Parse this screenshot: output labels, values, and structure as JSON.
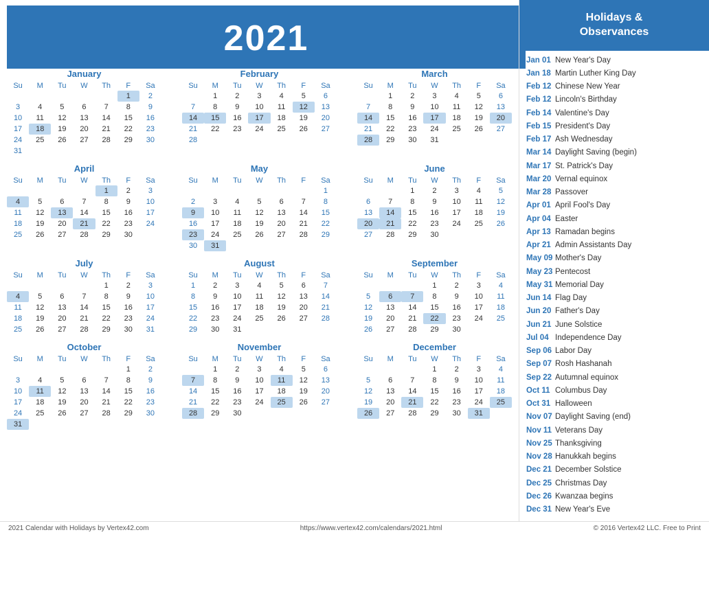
{
  "header": {
    "year": "2021"
  },
  "sidebar": {
    "title": "Holidays &\nObservances",
    "holidays": [
      {
        "date": "Jan 01",
        "name": "New Year's Day"
      },
      {
        "date": "Jan 18",
        "name": "Martin Luther King Day"
      },
      {
        "date": "Feb 12",
        "name": "Chinese New Year"
      },
      {
        "date": "Feb 12",
        "name": "Lincoln's Birthday"
      },
      {
        "date": "Feb 14",
        "name": "Valentine's Day"
      },
      {
        "date": "Feb 15",
        "name": "President's Day"
      },
      {
        "date": "Feb 17",
        "name": "Ash Wednesday"
      },
      {
        "date": "Mar 14",
        "name": "Daylight Saving (begin)"
      },
      {
        "date": "Mar 17",
        "name": "St. Patrick's Day"
      },
      {
        "date": "Mar 20",
        "name": "Vernal equinox"
      },
      {
        "date": "Mar 28",
        "name": "Passover"
      },
      {
        "date": "Apr 01",
        "name": "April Fool's Day"
      },
      {
        "date": "Apr 04",
        "name": "Easter"
      },
      {
        "date": "Apr 13",
        "name": "Ramadan begins"
      },
      {
        "date": "Apr 21",
        "name": "Admin Assistants Day"
      },
      {
        "date": "May 09",
        "name": "Mother's Day"
      },
      {
        "date": "May 23",
        "name": "Pentecost"
      },
      {
        "date": "May 31",
        "name": "Memorial Day"
      },
      {
        "date": "Jun 14",
        "name": "Flag Day"
      },
      {
        "date": "Jun 20",
        "name": "Father's Day"
      },
      {
        "date": "Jun 21",
        "name": "June Solstice"
      },
      {
        "date": "Jul 04",
        "name": "Independence Day"
      },
      {
        "date": "Sep 06",
        "name": "Labor Day"
      },
      {
        "date": "Sep 07",
        "name": "Rosh Hashanah"
      },
      {
        "date": "Sep 22",
        "name": "Autumnal equinox"
      },
      {
        "date": "Oct 11",
        "name": "Columbus Day"
      },
      {
        "date": "Oct 31",
        "name": "Halloween"
      },
      {
        "date": "Nov 07",
        "name": "Daylight Saving (end)"
      },
      {
        "date": "Nov 11",
        "name": "Veterans Day"
      },
      {
        "date": "Nov 25",
        "name": "Thanksgiving"
      },
      {
        "date": "Nov 28",
        "name": "Hanukkah begins"
      },
      {
        "date": "Dec 21",
        "name": "December Solstice"
      },
      {
        "date": "Dec 25",
        "name": "Christmas Day"
      },
      {
        "date": "Dec 26",
        "name": "Kwanzaa begins"
      },
      {
        "date": "Dec 31",
        "name": "New Year's Eve"
      }
    ]
  },
  "footer": {
    "left": "2021 Calendar with Holidays by Vertex42.com",
    "center": "https://www.vertex42.com/calendars/2021.html",
    "right": "© 2016 Vertex42 LLC. Free to Print"
  },
  "months": [
    {
      "name": "January",
      "weeks": [
        [
          "",
          "",
          "",
          "",
          "",
          "1",
          "2"
        ],
        [
          "3",
          "4",
          "5",
          "6",
          "7",
          "8",
          "9"
        ],
        [
          "10",
          "11",
          "12",
          "13",
          "14",
          "15",
          "16"
        ],
        [
          "17",
          "18",
          "19",
          "20",
          "21",
          "22",
          "23"
        ],
        [
          "24",
          "25",
          "26",
          "27",
          "28",
          "29",
          "30"
        ],
        [
          "31",
          "",
          "",
          "",
          "",
          "",
          ""
        ]
      ],
      "highlights": [
        "1",
        "18"
      ],
      "today": []
    },
    {
      "name": "February",
      "weeks": [
        [
          "",
          "1",
          "2",
          "3",
          "4",
          "5",
          "6"
        ],
        [
          "7",
          "8",
          "9",
          "10",
          "11",
          "12",
          "13"
        ],
        [
          "14",
          "15",
          "16",
          "17",
          "18",
          "19",
          "20"
        ],
        [
          "21",
          "22",
          "23",
          "24",
          "25",
          "26",
          "27"
        ],
        [
          "28",
          "",
          "",
          "",
          "",
          "",
          ""
        ]
      ],
      "highlights": [
        "12",
        "14",
        "15",
        "17"
      ],
      "today": []
    },
    {
      "name": "March",
      "weeks": [
        [
          "",
          "1",
          "2",
          "3",
          "4",
          "5",
          "6"
        ],
        [
          "7",
          "8",
          "9",
          "10",
          "11",
          "12",
          "13"
        ],
        [
          "14",
          "15",
          "16",
          "17",
          "18",
          "19",
          "20"
        ],
        [
          "21",
          "22",
          "23",
          "24",
          "25",
          "26",
          "27"
        ],
        [
          "28",
          "29",
          "30",
          "31",
          "",
          "",
          ""
        ]
      ],
      "highlights": [
        "14",
        "17",
        "20",
        "28"
      ],
      "today": []
    },
    {
      "name": "April",
      "weeks": [
        [
          "",
          "",
          "",
          "",
          "1",
          "2",
          "3"
        ],
        [
          "4",
          "5",
          "6",
          "7",
          "8",
          "9",
          "10"
        ],
        [
          "11",
          "12",
          "13",
          "14",
          "15",
          "16",
          "17"
        ],
        [
          "18",
          "19",
          "20",
          "21",
          "22",
          "23",
          "24"
        ],
        [
          "25",
          "26",
          "27",
          "28",
          "29",
          "30",
          ""
        ]
      ],
      "highlights": [
        "1",
        "4",
        "13",
        "21"
      ],
      "today": []
    },
    {
      "name": "May",
      "weeks": [
        [
          "",
          "",
          "",
          "",
          "",
          "",
          "1"
        ],
        [
          "2",
          "3",
          "4",
          "5",
          "6",
          "7",
          "8"
        ],
        [
          "9",
          "10",
          "11",
          "12",
          "13",
          "14",
          "15"
        ],
        [
          "16",
          "17",
          "18",
          "19",
          "20",
          "21",
          "22"
        ],
        [
          "23",
          "24",
          "25",
          "26",
          "27",
          "28",
          "29"
        ],
        [
          "30",
          "31",
          "",
          "",
          "",
          "",
          ""
        ]
      ],
      "highlights": [
        "9",
        "23",
        "31"
      ],
      "today": []
    },
    {
      "name": "June",
      "weeks": [
        [
          "",
          "",
          "1",
          "2",
          "3",
          "4",
          "5"
        ],
        [
          "6",
          "7",
          "8",
          "9",
          "10",
          "11",
          "12"
        ],
        [
          "13",
          "14",
          "15",
          "16",
          "17",
          "18",
          "19"
        ],
        [
          "20",
          "21",
          "22",
          "23",
          "24",
          "25",
          "26"
        ],
        [
          "27",
          "28",
          "29",
          "30",
          "",
          "",
          ""
        ]
      ],
      "highlights": [
        "14",
        "20",
        "21"
      ],
      "today": []
    },
    {
      "name": "July",
      "weeks": [
        [
          "",
          "",
          "",
          "",
          "1",
          "2",
          "3"
        ],
        [
          "4",
          "5",
          "6",
          "7",
          "8",
          "9",
          "10"
        ],
        [
          "11",
          "12",
          "13",
          "14",
          "15",
          "16",
          "17"
        ],
        [
          "18",
          "19",
          "20",
          "21",
          "22",
          "23",
          "24"
        ],
        [
          "25",
          "26",
          "27",
          "28",
          "29",
          "30",
          "31"
        ]
      ],
      "highlights": [
        "4"
      ],
      "today": []
    },
    {
      "name": "August",
      "weeks": [
        [
          "1",
          "2",
          "3",
          "4",
          "5",
          "6",
          "7"
        ],
        [
          "8",
          "9",
          "10",
          "11",
          "12",
          "13",
          "14"
        ],
        [
          "15",
          "16",
          "17",
          "18",
          "19",
          "20",
          "21"
        ],
        [
          "22",
          "23",
          "24",
          "25",
          "26",
          "27",
          "28"
        ],
        [
          "29",
          "30",
          "31",
          "",
          "",
          "",
          ""
        ]
      ],
      "highlights": [],
      "today": []
    },
    {
      "name": "September",
      "weeks": [
        [
          "",
          "",
          "",
          "1",
          "2",
          "3",
          "4"
        ],
        [
          "5",
          "6",
          "7",
          "8",
          "9",
          "10",
          "11"
        ],
        [
          "12",
          "13",
          "14",
          "15",
          "16",
          "17",
          "18"
        ],
        [
          "19",
          "20",
          "21",
          "22",
          "23",
          "24",
          "25"
        ],
        [
          "26",
          "27",
          "28",
          "29",
          "30",
          "",
          ""
        ]
      ],
      "highlights": [
        "6",
        "7",
        "22"
      ],
      "today": []
    },
    {
      "name": "October",
      "weeks": [
        [
          "",
          "",
          "",
          "",
          "",
          "1",
          "2"
        ],
        [
          "3",
          "4",
          "5",
          "6",
          "7",
          "8",
          "9"
        ],
        [
          "10",
          "11",
          "12",
          "13",
          "14",
          "15",
          "16"
        ],
        [
          "17",
          "18",
          "19",
          "20",
          "21",
          "22",
          "23"
        ],
        [
          "24",
          "25",
          "26",
          "27",
          "28",
          "29",
          "30"
        ],
        [
          "31",
          "",
          "",
          "",
          "",
          "",
          ""
        ]
      ],
      "highlights": [
        "11",
        "31"
      ],
      "today": []
    },
    {
      "name": "November",
      "weeks": [
        [
          "",
          "1",
          "2",
          "3",
          "4",
          "5",
          "6"
        ],
        [
          "7",
          "8",
          "9",
          "10",
          "11",
          "12",
          "13"
        ],
        [
          "14",
          "15",
          "16",
          "17",
          "18",
          "19",
          "20"
        ],
        [
          "21",
          "22",
          "23",
          "24",
          "25",
          "26",
          "27"
        ],
        [
          "28",
          "29",
          "30",
          "",
          "",
          "",
          ""
        ]
      ],
      "highlights": [
        "7",
        "11",
        "25",
        "28"
      ],
      "today": []
    },
    {
      "name": "December",
      "weeks": [
        [
          "",
          "",
          "",
          "1",
          "2",
          "3",
          "4"
        ],
        [
          "5",
          "6",
          "7",
          "8",
          "9",
          "10",
          "11"
        ],
        [
          "12",
          "13",
          "14",
          "15",
          "16",
          "17",
          "18"
        ],
        [
          "19",
          "20",
          "21",
          "22",
          "23",
          "24",
          "25"
        ],
        [
          "26",
          "27",
          "28",
          "29",
          "30",
          "31",
          ""
        ]
      ],
      "highlights": [
        "21",
        "25",
        "26",
        "31"
      ],
      "today": []
    }
  ]
}
